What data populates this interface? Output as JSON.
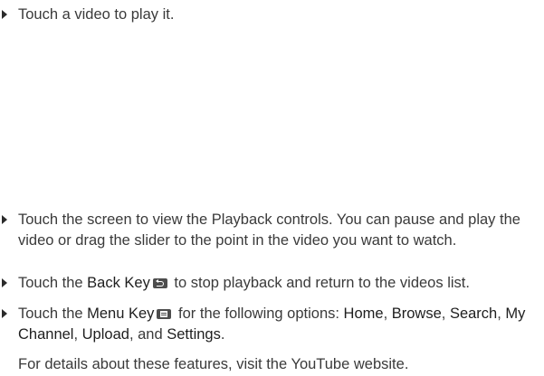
{
  "bullets": {
    "b1": "Touch a video to play it.",
    "b2": "Touch the screen to view the Playback controls. You can pause and play the video or drag the slider to the point in the video you want to watch.",
    "b3": {
      "prefix": "Touch the ",
      "key_name": "Back Key",
      "key_icon": "back-key-icon",
      "suffix": " to stop playback and return to the videos list."
    },
    "b4": {
      "prefix": "Touch the ",
      "key_name": "Menu Key",
      "key_icon": "menu-key-icon",
      "mid": " for the following options: ",
      "options": [
        "Home",
        "Browse",
        "Search",
        "My Channel",
        "Upload",
        "Settings"
      ],
      "sep1": ", ",
      "and": ", and ",
      "end": "."
    }
  },
  "note": "For details about these features, visit the YouTube website."
}
